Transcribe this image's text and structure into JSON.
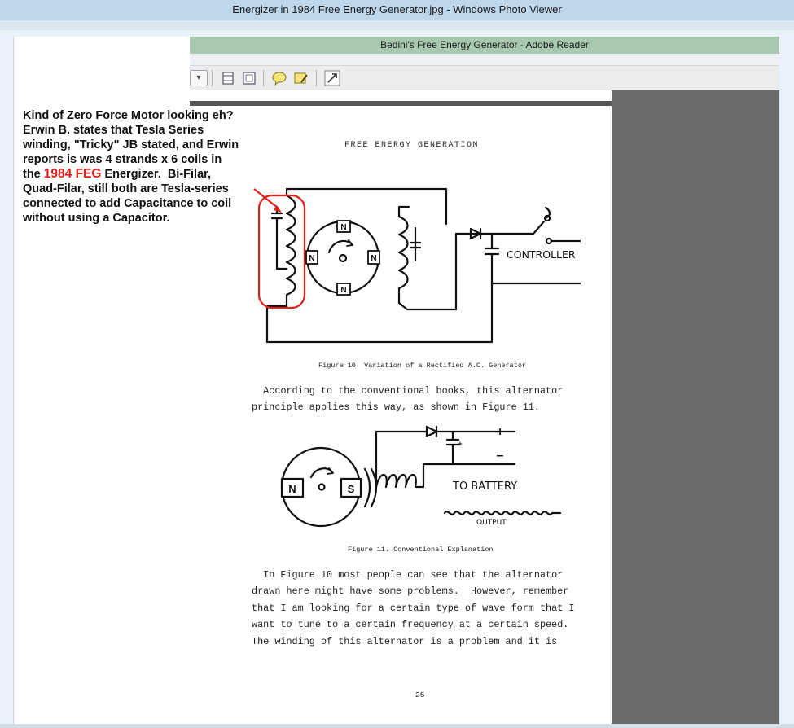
{
  "window": {
    "title": "Energizer in 1984 Free Energy Generator.jpg - Windows Photo Viewer"
  },
  "inner_window": {
    "title": "Bedini's Free Energy Generator - Adobe Reader"
  },
  "toolbar": {
    "dropdown_glyph": "▾",
    "icons": [
      "page-fit-icon",
      "fit-width-icon",
      "comment-icon",
      "highlight-icon",
      "fullscreen-icon"
    ]
  },
  "annotation": {
    "line1": "Kind of Zero Force Motor looking eh?",
    "line2": "Erwin B. states that Tesla Series",
    "line3": "winding, \"Tricky\" JB stated, and Erwin",
    "line4": "reports is was 4 strands x 6 coils in",
    "line5_pre": "the ",
    "line5_red": "1984 FEG",
    "line5_post": " Energizer.  Bi-Filar,",
    "line6": "Quad-Filar, still both are Tesla-series",
    "line7": "connected to add Capacitance to coil",
    "line8": "without using a Capacitor.",
    "highlight_color": "#e0201a"
  },
  "document": {
    "heading": "FREE ENERGY GENERATION",
    "fig10": {
      "caption": "Figure 10.  Variation of a Rectified A.C. Generator",
      "pole_labels": [
        "N",
        "N",
        "N",
        "N"
      ],
      "controller_label": "CONTROLLER"
    },
    "para1_line1": "  According to the conventional books, this alternator",
    "para1_line2": "principle applies this way, as shown in Figure 11.",
    "fig11": {
      "caption": "Figure 11.  Conventional Explanation",
      "pole_n": "N",
      "pole_s": "S",
      "plus_label": "+",
      "minus_label": "–",
      "battery_label": "TO BATTERY",
      "output_label": "OUTPUT"
    },
    "para2_line1": "  In Figure 10 most people can see that the alternator",
    "para2_line2": "drawn here might have some problems.  However, remember",
    "para2_line3": "that I am looking for a certain type of wave form that I",
    "para2_line4": "want to tune to a certain frequency at a certain speed.",
    "para2_line5": "The winding of this alternator is a problem and it is",
    "page_number": "25"
  }
}
